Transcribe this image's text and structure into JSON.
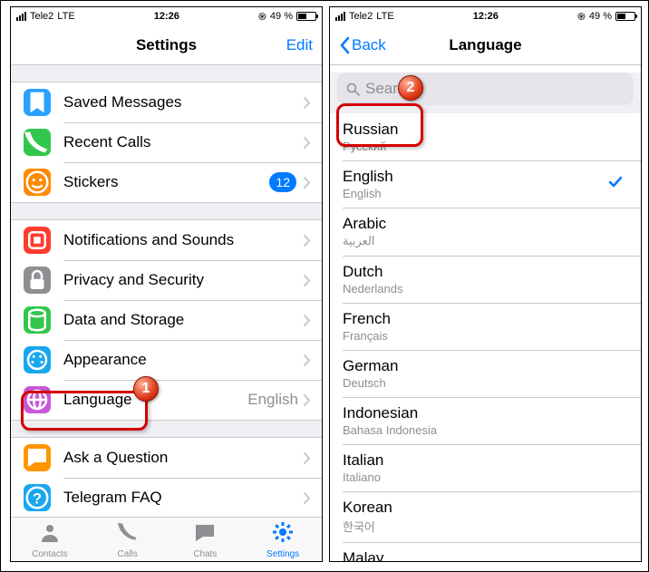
{
  "status": {
    "carrier": "Tele2",
    "net": "LTE",
    "time": "12:26",
    "alarm_icon": "⏱",
    "battery_pct": "49 %"
  },
  "left": {
    "nav": {
      "title": "Settings",
      "edit": "Edit"
    },
    "group1": [
      {
        "icon": "bookmark",
        "color": "#2aa1ff",
        "label": "Saved Messages"
      },
      {
        "icon": "phone",
        "color": "#31c74c",
        "label": "Recent Calls"
      },
      {
        "icon": "sticker",
        "color": "#ff8a00",
        "label": "Stickers",
        "badge": "12"
      }
    ],
    "group2": [
      {
        "icon": "bell",
        "color": "#ff3b30",
        "label": "Notifications and Sounds"
      },
      {
        "icon": "lock",
        "color": "#8e8e93",
        "label": "Privacy and Security"
      },
      {
        "icon": "data",
        "color": "#31c74c",
        "label": "Data and Storage"
      },
      {
        "icon": "brush",
        "color": "#18a7ef",
        "label": "Appearance"
      },
      {
        "icon": "globe",
        "color": "#c858d6",
        "label": "Language",
        "value": "English"
      }
    ],
    "group3": [
      {
        "icon": "chat",
        "color": "#ff9500",
        "label": "Ask a Question"
      },
      {
        "icon": "faq",
        "color": "#18a7ef",
        "label": "Telegram FAQ"
      }
    ],
    "tabs": [
      {
        "label": "Contacts"
      },
      {
        "label": "Calls"
      },
      {
        "label": "Chats"
      },
      {
        "label": "Settings",
        "active": true
      }
    ]
  },
  "right": {
    "nav": {
      "back": "Back",
      "title": "Language"
    },
    "search_ph": "Search",
    "languages": [
      {
        "name": "Russian",
        "native": "Русский"
      },
      {
        "name": "English",
        "native": "English",
        "selected": true
      },
      {
        "name": "Arabic",
        "native": "العربية"
      },
      {
        "name": "Dutch",
        "native": "Nederlands"
      },
      {
        "name": "French",
        "native": "Français"
      },
      {
        "name": "German",
        "native": "Deutsch"
      },
      {
        "name": "Indonesian",
        "native": "Bahasa Indonesia"
      },
      {
        "name": "Italian",
        "native": "Italiano"
      },
      {
        "name": "Korean",
        "native": "한국어"
      },
      {
        "name": "Malay",
        "native": ""
      }
    ]
  },
  "callouts": {
    "one": "1",
    "two": "2"
  }
}
